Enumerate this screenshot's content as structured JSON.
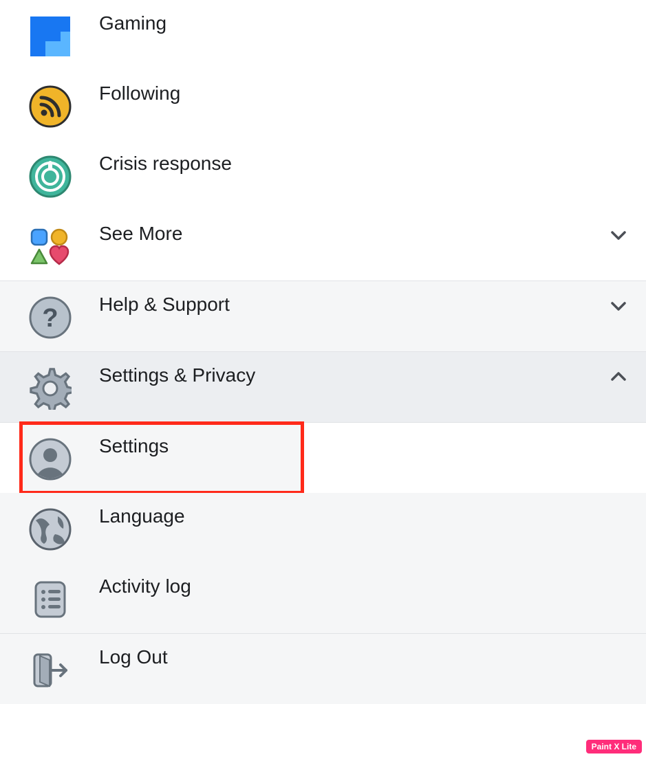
{
  "menu": {
    "items": [
      {
        "label": "Gaming"
      },
      {
        "label": "Following"
      },
      {
        "label": "Crisis response"
      },
      {
        "label": "See More"
      },
      {
        "label": "Help & Support"
      },
      {
        "label": "Settings & Privacy"
      },
      {
        "label": "Settings"
      },
      {
        "label": "Language"
      },
      {
        "label": "Activity log"
      },
      {
        "label": "Log Out"
      }
    ]
  },
  "watermark": "Paint X Lite"
}
